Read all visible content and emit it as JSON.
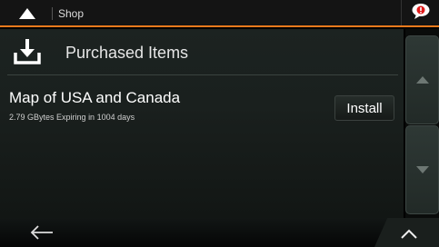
{
  "header": {
    "title": "Shop",
    "home_icon": "up-triangle-icon",
    "message_icon": "speech-bubble-alert-icon",
    "accent_color": "#f07a1c"
  },
  "section": {
    "title": "Purchased Items",
    "icon": "download-tray-icon"
  },
  "items": [
    {
      "name": "Map of USA and Canada",
      "size": "2.79 GBytes",
      "expiry": "Expiring in 1004 days",
      "action_label": "Install"
    }
  ],
  "scrollbar": {
    "up_icon": "triangle-up-icon",
    "down_icon": "triangle-down-icon"
  },
  "footer": {
    "back_icon": "back-arrow-icon",
    "more_icon": "chevron-up-icon"
  }
}
